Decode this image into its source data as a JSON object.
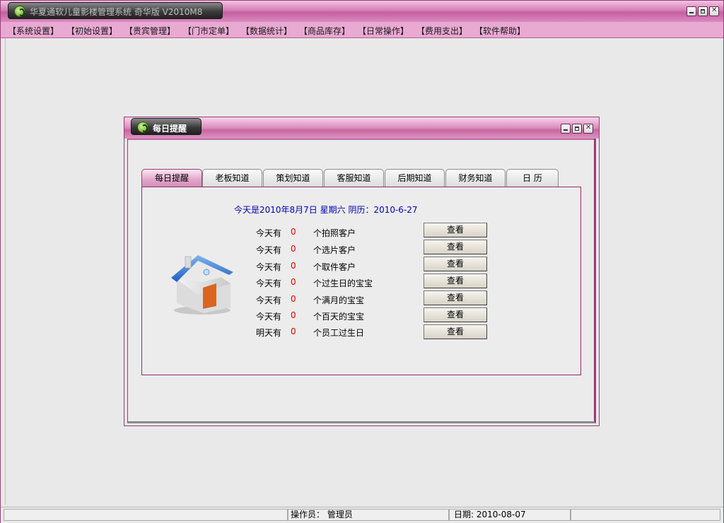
{
  "app": {
    "title": "华夏通软儿童影楼管理系统 奇华版 V2010M8"
  },
  "menu": [
    "【系统设置】",
    "【初始设置】",
    "【贵宾管理】",
    "【门市定单】",
    "【数据统计】",
    "【商品库存】",
    "【日常操作】",
    "【费用支出】",
    "【软件帮助】"
  ],
  "child_window": {
    "title": "每日提醒",
    "tabs": [
      "每日提醒",
      "老板知道",
      "策划知道",
      "客服知道",
      "后期知道",
      "财务知道",
      "日 历"
    ],
    "date_line": "今天是2010年8月7日  星期六   阴历：2010-6-27",
    "rows": [
      {
        "label": "今天有",
        "count": "0",
        "desc": "个拍照客户",
        "button": "查看"
      },
      {
        "label": "今天有",
        "count": "0",
        "desc": "个选片客户",
        "button": "查看"
      },
      {
        "label": "今天有",
        "count": "0",
        "desc": "个取件客户",
        "button": "查看"
      },
      {
        "label": "今天有",
        "count": "0",
        "desc": "个过生日的宝宝",
        "button": "查看"
      },
      {
        "label": "今天有",
        "count": "0",
        "desc": "个满月的宝宝",
        "button": "查看"
      },
      {
        "label": "今天有",
        "count": "0",
        "desc": "个百天的宝宝",
        "button": "查看"
      },
      {
        "label": "明天有",
        "count": "0",
        "desc": "个员工过生日",
        "button": "查看"
      }
    ]
  },
  "status": {
    "operator": "操作员：  管理员",
    "date": "日期:  2010-08-07"
  },
  "icons": {
    "app_logo": "app-logo-icon",
    "house": "house-icon"
  },
  "colors": {
    "theme_pink": "#d57eb6",
    "date_text": "#0000b4",
    "count_text": "#e00000"
  }
}
